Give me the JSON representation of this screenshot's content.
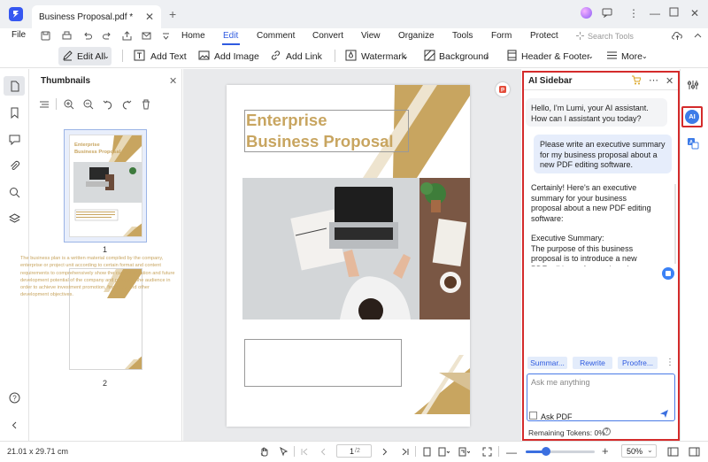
{
  "app": {
    "tab_title": "Business Proposal.pdf *"
  },
  "menu": {
    "file": "File",
    "items": [
      "Home",
      "Edit",
      "Comment",
      "Convert",
      "View",
      "Organize",
      "Tools",
      "Form",
      "Protect"
    ],
    "search_tools": "Search Tools"
  },
  "toolbar": {
    "edit_all": "Edit All",
    "add_text": "Add Text",
    "add_image": "Add Image",
    "add_link": "Add Link",
    "watermark": "Watermark",
    "background": "Background",
    "header_footer": "Header & Footer",
    "more": "More"
  },
  "thumbnails": {
    "title": "Thumbnails",
    "page1_num": "1",
    "page2_num": "2",
    "mini_title_line1": "Enterprise",
    "mini_title_line2": "Business Proposal"
  },
  "document": {
    "title_line1": "Enterprise",
    "title_line2": "Business Proposal",
    "paragraph": "The business plan is a written material compiled by the company, enterprise or project unit according to certain format and content requirements to comprehensively show the current situation and future development potential of the company and project to the audience in order to achieve investment promotion, financing and other development objectives."
  },
  "ai_sidebar": {
    "title": "AI Sidebar",
    "msg_assistant_1": "Hello, I'm Lumi, your AI assistant. How can I assistant you today?",
    "msg_user_1": "Please write an executive summary for my business proposal about a new PDF editing software.",
    "msg_assistant_2_p1": "Certainly! Here's an executive summary for your business proposal about a new PDF editing software:",
    "msg_assistant_2_p2": "Executive Summary:",
    "msg_assistant_2_p3": "The purpose of this business proposal is to introduce a new PDF editing software that aims to revolutionize the way users manage and work with PDF documents.",
    "chips": [
      "Summar...",
      "Rewrite",
      "Proofre..."
    ],
    "input_placeholder": "Ask me anything",
    "ask_pdf": "Ask PDF",
    "tokens": "Remaining Tokens: 0%",
    "tokens_help": "?"
  },
  "rightrail": {
    "ai_label": "AI"
  },
  "status": {
    "page_size": "21.01 x 29.71 cm",
    "page_current": "1",
    "page_total": "/2",
    "zoom": "50%",
    "zoom_level": 0.3
  },
  "colors": {
    "accent": "#2f5be0",
    "highlight": "#d42b2b",
    "doc_gold": "#c8a560"
  }
}
